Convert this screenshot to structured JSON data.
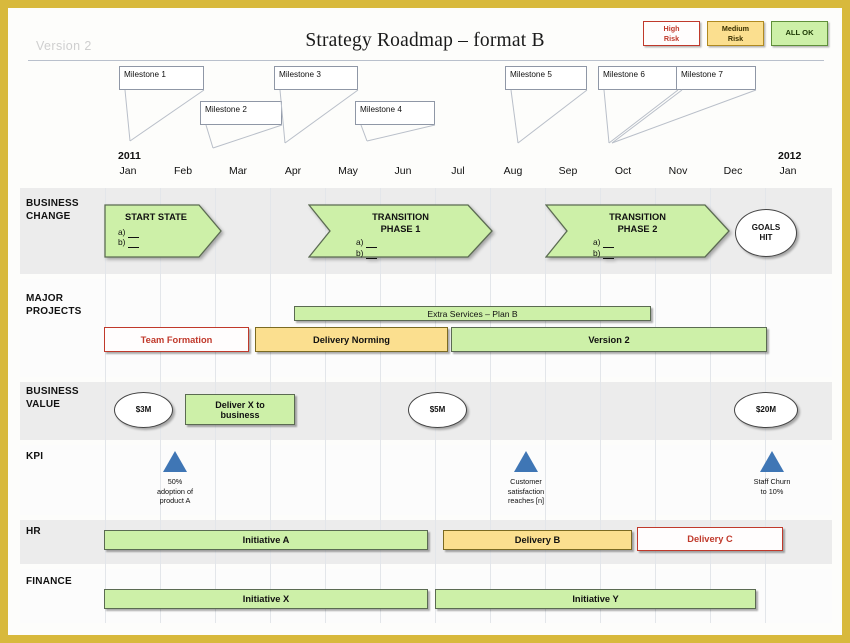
{
  "document": {
    "version_label": "Version 2",
    "title": "Strategy Roadmap – format B"
  },
  "legend": [
    {
      "id": "high-risk",
      "line1": "High",
      "line2": "Risk",
      "color": "#c0392b"
    },
    {
      "id": "medium-risk",
      "line1": "Medium",
      "line2": "Risk",
      "color": "#b08a20"
    },
    {
      "id": "all-ok",
      "line1": "ALL OK",
      "line2": "",
      "color": "#5f8f3a"
    }
  ],
  "timeline": {
    "start_year": "2011",
    "end_year": "2012",
    "months": [
      "Jan",
      "Feb",
      "Mar",
      "Apr",
      "May",
      "Jun",
      "Jul",
      "Aug",
      "Sep",
      "Oct",
      "Nov",
      "Dec",
      "Jan"
    ]
  },
  "milestones": [
    {
      "label": "Milestone 1"
    },
    {
      "label": "Milestone 2"
    },
    {
      "label": "Milestone 3"
    },
    {
      "label": "Milestone 4"
    },
    {
      "label": "Milestone 5"
    },
    {
      "label": "Milestone 6"
    },
    {
      "label": "Milestone 7"
    }
  ],
  "lanes": [
    {
      "id": "business-change",
      "label_line1": "BUSINESS",
      "label_line2": "CHANGE"
    },
    {
      "id": "major-projects",
      "label_line1": "MAJOR",
      "label_line2": "PROJECTS"
    },
    {
      "id": "business-value",
      "label_line1": "BUSINESS",
      "label_line2": "VALUE"
    },
    {
      "id": "kpi",
      "label_line1": "KPI",
      "label_line2": ""
    },
    {
      "id": "hr",
      "label_line1": "HR",
      "label_line2": ""
    },
    {
      "id": "finance",
      "label_line1": "FINANCE",
      "label_line2": ""
    }
  ],
  "business_change": {
    "phases": [
      {
        "heading": "START STATE",
        "a": "a)",
        "b": "b)"
      },
      {
        "heading_line1": "TRANSITION",
        "heading_line2": "PHASE 1",
        "a": "a)",
        "b": "b)"
      },
      {
        "heading_line1": "TRANSITION",
        "heading_line2": "PHASE 2",
        "a": "a)",
        "b": "b)"
      }
    ],
    "goal": {
      "line1": "GOALS",
      "line2": "HIT"
    }
  },
  "major_projects": {
    "top_bar": {
      "label": "Extra Services – Plan B",
      "status": "green"
    },
    "bars": [
      {
        "label": "Team Formation",
        "status": "red"
      },
      {
        "label": "Delivery Norming",
        "status": "gold"
      },
      {
        "label": "Version 2",
        "status": "green"
      }
    ]
  },
  "business_value": {
    "markers": [
      {
        "label": "$3M"
      },
      {
        "label": "$5M"
      },
      {
        "label": "$20M"
      }
    ],
    "box": {
      "line1": "Deliver X to",
      "line2": "business"
    }
  },
  "kpi": {
    "items": [
      {
        "line1": "50%",
        "line2": "adoption of",
        "line3": "product A"
      },
      {
        "line1": "Customer",
        "line2": "satisfaction",
        "line3": "reaches [n]"
      },
      {
        "line1": "Staff Churn",
        "line2": "to 10%",
        "line3": ""
      }
    ]
  },
  "hr": {
    "bars": [
      {
        "label": "Initiative A",
        "status": "green"
      },
      {
        "label": "Delivery B",
        "status": "gold"
      },
      {
        "label": "Delivery C",
        "status": "red"
      }
    ]
  },
  "finance": {
    "bars": [
      {
        "label": "Initiative X",
        "status": "green"
      },
      {
        "label": "Initiative Y",
        "status": "green"
      }
    ]
  },
  "colors": {
    "frame": "#d8b93c",
    "green": "#cdf0a8",
    "gold": "#fbdf8f",
    "red": "#c0392b",
    "kpi_triangle": "#3f76b5",
    "lane_gray": "#ececec"
  }
}
